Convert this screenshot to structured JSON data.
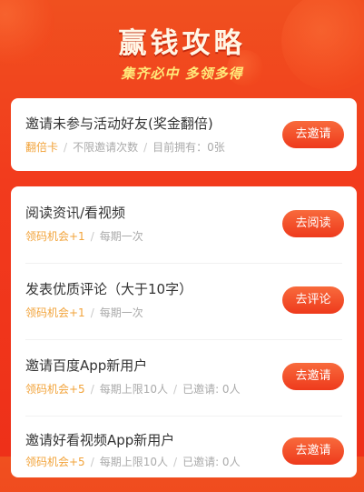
{
  "header": {
    "title": "赢钱攻略",
    "subtitle": "集齐必中 多领多得"
  },
  "invite_card": {
    "title": "邀请未参与活动好友(奖金翻倍)",
    "meta": [
      "翻倍卡",
      "不限邀请次数",
      "目前拥有：0张"
    ],
    "button": "去邀请"
  },
  "tasks": [
    {
      "title": "阅读资讯/看视频",
      "meta": [
        "领码机会+1",
        "每期一次"
      ],
      "button": "去阅读"
    },
    {
      "title": "发表优质评论（大于10字）",
      "meta": [
        "领码机会+1",
        "每期一次"
      ],
      "button": "去评论"
    },
    {
      "title": "邀请百度App新用户",
      "meta": [
        "领码机会+5",
        "每期上限10人",
        "已邀请: 0人"
      ],
      "button": "去邀请"
    },
    {
      "title": "邀请好看视频App新用户",
      "meta": [
        "领码机会+5",
        "每期上限10人",
        "已邀请: 0人"
      ],
      "button": "去邀请"
    }
  ],
  "colors": {
    "brand": "#f23b1d",
    "highlight": "#f2a33a",
    "button": "#ee3a1c"
  }
}
